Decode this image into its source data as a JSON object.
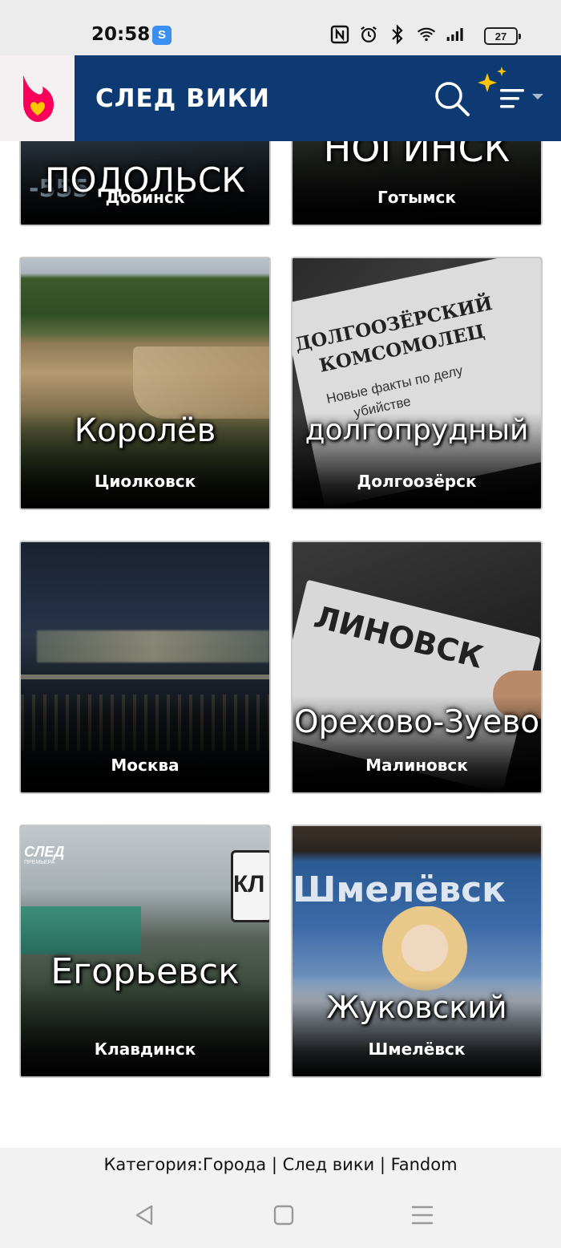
{
  "status_bar": {
    "time": "20:58",
    "app_badge": "S",
    "battery_level": "27",
    "icons": [
      "nfc-icon",
      "alarm-icon",
      "bluetooth-icon",
      "wifi-icon",
      "signal-icon",
      "battery-icon"
    ]
  },
  "header": {
    "wiki_name": "СЛЕД ВИКИ",
    "brand_color": "#0e3a74",
    "logo_color": "#fa005a"
  },
  "gallery": {
    "cards": [
      {
        "caption": "Добинск",
        "overlay": "ПОДОЛЬСК"
      },
      {
        "caption": "Готымск",
        "overlay": "НОГИНСК"
      },
      {
        "caption": "Циолковск",
        "overlay": "Королёв"
      },
      {
        "caption": "Долгоозёрск",
        "overlay": "долгопрудный",
        "image_text": [
          "ДОЛГООЗЁРСКИЙ",
          "КОМСОМОЛЕЦ",
          "Новые факты по делу",
          "убийстве"
        ]
      },
      {
        "caption": "Москва",
        "overlay": ""
      },
      {
        "caption": "Малиновск",
        "overlay": "Орехово-Зуево",
        "image_text": [
          "ЛИНОВСК"
        ]
      },
      {
        "caption": "Клавдинск",
        "overlay": "Егорьевск",
        "image_text": [
          "СЛЕД",
          "ПРЕМЬЕРА",
          "КЛ"
        ]
      },
      {
        "caption": "Шмелёвск",
        "overlay": "Жуковский",
        "image_text": [
          "Шмелёвск"
        ]
      }
    ]
  },
  "footer": {
    "page_title": "Категория:Города | След вики | Fandom"
  },
  "nav": {
    "buttons": [
      "back-button",
      "home-button",
      "recents-button"
    ]
  }
}
